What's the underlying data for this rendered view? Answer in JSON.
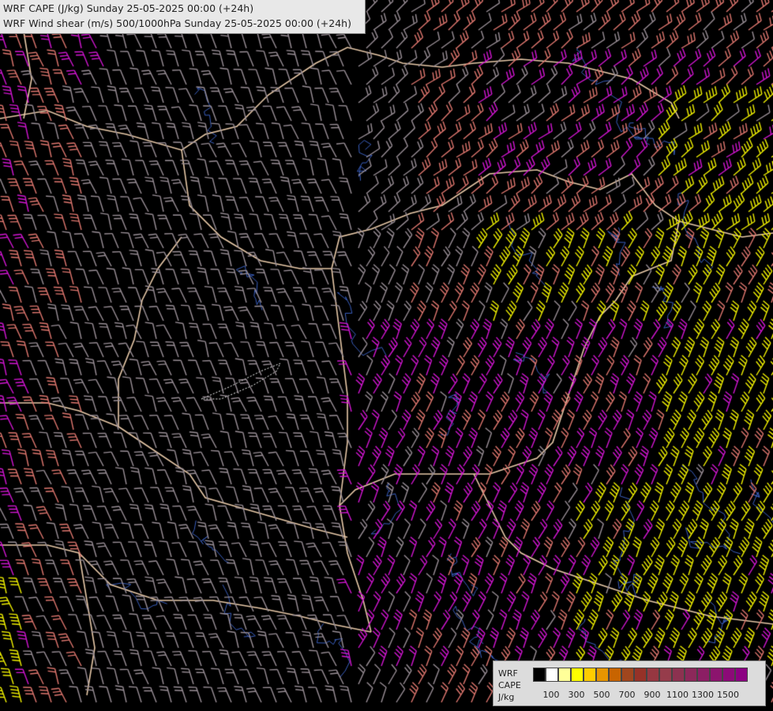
{
  "title": {
    "line1": "WRF CAPE (J/kg) Sunday 25-05-2025 00:00 (+24h)",
    "line2": "WRF Wind shear (m/s) 500/1000hPa Sunday 25-05-2025 00:00 (+24h)"
  },
  "legend": {
    "name_line1": "WRF",
    "name_line2": "CAPE",
    "name_line3": "J/kg",
    "swatch_colors": [
      "#000000",
      "#ffffff",
      "#ffff99",
      "#ffff00",
      "#ffcc00",
      "#e69500",
      "#c86400",
      "#a0461e",
      "#963228",
      "#963741",
      "#963c4b",
      "#8c3250",
      "#8c285a",
      "#8c1e64",
      "#8c146e",
      "#8c0a78",
      "#8c0082"
    ],
    "tick_labels": [
      "100",
      "300",
      "500",
      "700",
      "900",
      "1100",
      "1300",
      "1500"
    ]
  },
  "barb_colors": {
    "gray": "#9a8f97",
    "salmon": "#e0776f",
    "magenta": "#d216d2",
    "yellow": "#f0f000"
  },
  "border_color": "#e8c9a8",
  "river_color": "#3a5fbf"
}
